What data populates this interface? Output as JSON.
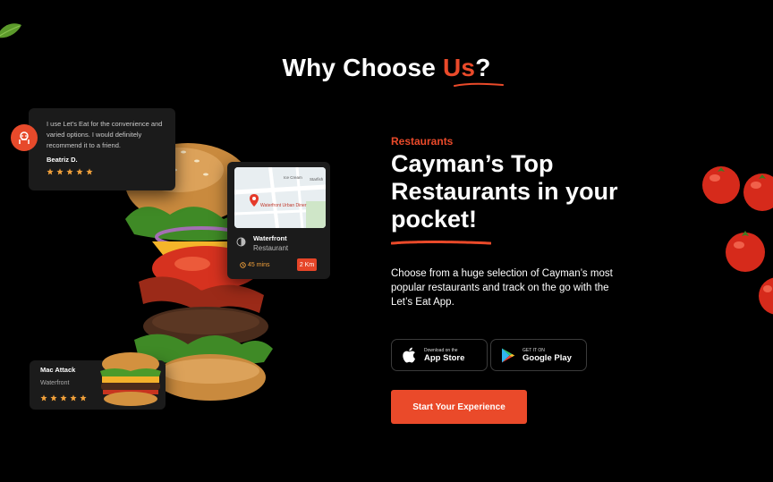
{
  "section": {
    "title_prefix": "Why Choose ",
    "title_accent": "Us",
    "title_suffix": "?"
  },
  "review": {
    "quote": "I use Let's Eat for the convenience and varied options. I would definitely recommend it to a friend.",
    "name": "Beatriz D.",
    "rating": 5
  },
  "map_card": {
    "map_labels": [
      "Waterfront Urban Diner",
      "Ice Cream",
      "Starfish"
    ],
    "place_name": "Waterfront",
    "place_type": "Restaurant",
    "time": "45 mins",
    "distance": "2 Km"
  },
  "mac_card": {
    "name": "Mac Attack",
    "location": "Waterfront",
    "rating": 5
  },
  "content": {
    "eyebrow": "Restaurants",
    "headline": "Cayman’s Top Restaurants in your pocket!",
    "description": "Choose from a huge selection of Cayman’s most popular restaurants and track on the go with the Let’s Eat App."
  },
  "buttons": {
    "app_store_small": "Download on the",
    "app_store_big": "App Store",
    "google_play_small": "GET IT ON",
    "google_play_big": "Google Play",
    "cta": "Start Your Experience"
  },
  "colors": {
    "accent": "#ea4a2a",
    "star": "#f2a13b",
    "card_bg": "#1b1b1b"
  },
  "icons": [
    "leaf-icon",
    "restaurant-avatar-icon",
    "star-icon",
    "map-pin-icon",
    "place-type-icon",
    "clock-icon",
    "apple-icon",
    "google-play-icon",
    "tomato-icon"
  ]
}
